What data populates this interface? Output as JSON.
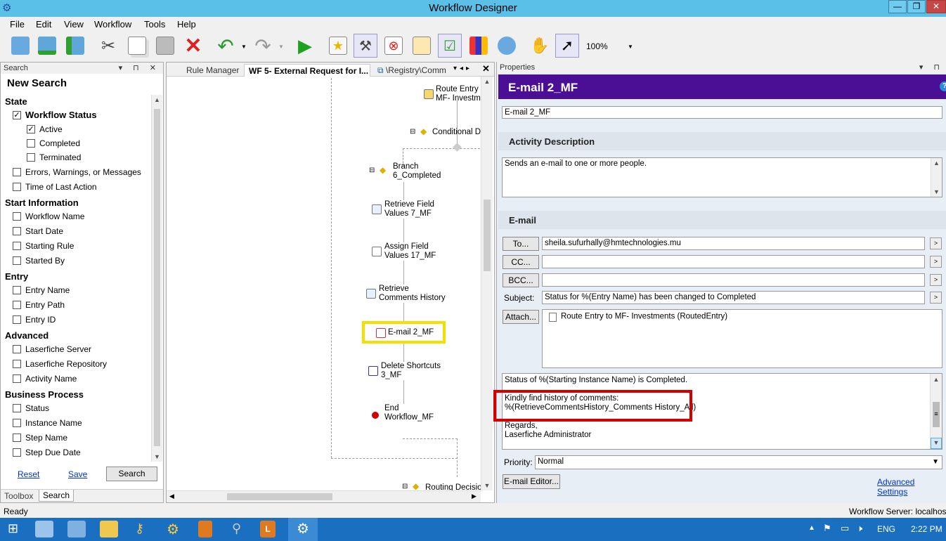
{
  "window": {
    "title": "Workflow Designer",
    "controls": [
      "—",
      "❐",
      "✕"
    ]
  },
  "menu": [
    {
      "label": "File"
    },
    {
      "label": "Edit"
    },
    {
      "label": "View"
    },
    {
      "label": "Workflow"
    },
    {
      "label": "Tools"
    },
    {
      "label": "Help"
    }
  ],
  "toolbar": {
    "zoom": "100%",
    "icons": [
      "new-workflow-icon",
      "open-workflow-icon",
      "publish-icon",
      "cut-icon",
      "copy-icon",
      "paste-icon",
      "delete-icon",
      "undo-icon",
      "redo-icon",
      "run-icon",
      "find-icon",
      "tools-icon",
      "stop-icon",
      "outline-icon",
      "checklist-icon",
      "chart-icon",
      "help-search-icon",
      "pan-hand-icon",
      "pointer-icon"
    ]
  },
  "search_panel": {
    "title": "Search",
    "heading": "New Search",
    "sections": [
      {
        "label": "State"
      },
      {
        "label": "Start Information"
      },
      {
        "label": "Entry"
      },
      {
        "label": "Advanced"
      },
      {
        "label": "Business Process"
      }
    ],
    "items": {
      "workflow_status": "Workflow Status",
      "active": "Active",
      "completed": "Completed",
      "terminated": "Terminated",
      "errors": "Errors, Warnings, or Messages",
      "time_last": "Time of Last Action",
      "workflow_name": "Workflow Name",
      "start_date": "Start Date",
      "starting_rule": "Starting Rule",
      "started_by": "Started By",
      "entry_name": "Entry Name",
      "entry_path": "Entry Path",
      "entry_id": "Entry ID",
      "lf_server": "Laserfiche Server",
      "lf_repo": "Laserfiche Repository",
      "activity_name": "Activity Name",
      "status": "Status",
      "instance_name": "Instance Name",
      "step_name": "Step Name",
      "step_due_date": "Step Due Date"
    },
    "reset": "Reset",
    "save": "Save",
    "search": "Search",
    "bottom_tabs": [
      "Toolbox",
      "Search"
    ]
  },
  "designer": {
    "tabs": [
      "Rule Manager",
      "WF 5- External Request for I...",
      "\\Registry\\Comm"
    ],
    "activities": {
      "route_entry": "Route Entry t",
      "route_entry2": "MF- Investme",
      "conditional": "Conditional De",
      "branch1": "Branch",
      "branch2": "6_Completed",
      "rfv1": "Retrieve Field",
      "rfv2": "Values 7_MF",
      "afv1": "Assign Field",
      "afv2": "Values 17_MF",
      "rch1": "Retrieve",
      "rch2": "Comments History",
      "email": "E-mail 2_MF",
      "del1": "Delete Shortcuts",
      "del2": "3_MF",
      "end1": "End",
      "end2": "Workflow_MF",
      "routing": "Routing Decisio"
    }
  },
  "properties": {
    "title": "Properties",
    "header": "E-mail 2_MF",
    "name_value": "E-mail 2_MF",
    "activity_description_label": "Activity Description",
    "description": "Sends an e-mail to one or more people.",
    "email_label": "E-mail",
    "to_button": "To...",
    "to_value": "sheila.sufurhally@hmtechnologies.mu",
    "cc_button": "CC...",
    "cc_value": "",
    "bcc_button": "BCC...",
    "bcc_value": "",
    "subject_label": "Subject:",
    "subject_value": "Status for %(Entry Name) has been changed to Completed",
    "attach_button": "Attach...",
    "attachment": "Route Entry to MF- Investments (RoutedEntry)",
    "body_line1": "Status of %(Starting Instance Name) is Completed.",
    "body_line2": "Kindly find history of comments:",
    "body_line3": "%(RetrieveCommentsHistory_Comments History_All)",
    "body_line4": "Regards,",
    "body_line5": "Laserfiche Administrator",
    "priority_label": "Priority:",
    "priority_value": "Normal",
    "email_editor_button": "E-mail Editor...",
    "advanced_settings": "Advanced Settings"
  },
  "status": {
    "left": "Ready",
    "right": "Workflow Server: localhost"
  },
  "taskbar": {
    "language": "ENG",
    "time": "2:22 PM"
  },
  "highlight_colors": {
    "yellow": "#f2e000",
    "red": "#d40000",
    "header_purple": "#4b0f96"
  }
}
